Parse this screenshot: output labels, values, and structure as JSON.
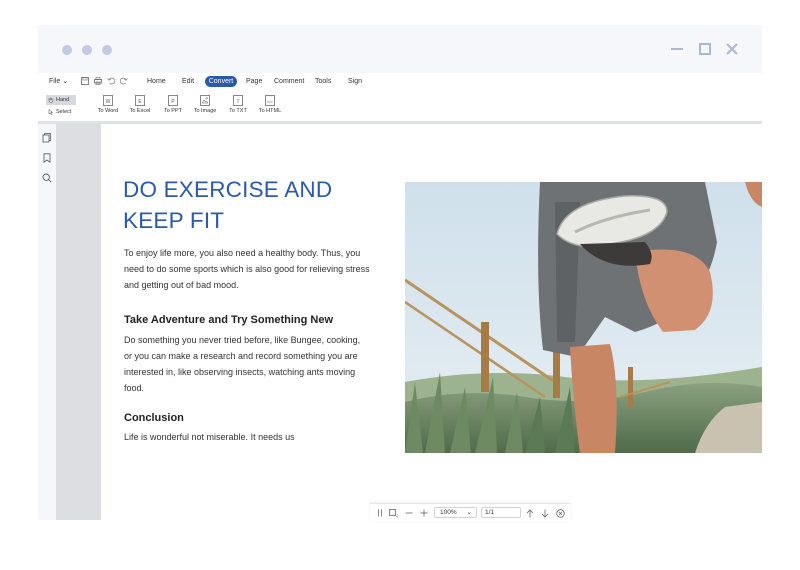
{
  "menu": {
    "file": "File",
    "tabs": [
      "Home",
      "Edit",
      "Convert",
      "Page",
      "Comment",
      "Tools",
      "Sign"
    ],
    "active_tab": "Convert"
  },
  "toolbar": {
    "hand": "Hand",
    "select": "Select",
    "tools": [
      "To Word",
      "To Excel",
      "To PPT",
      "To Image",
      "To TXT",
      "To HTML"
    ]
  },
  "document": {
    "heading_line1": "DO EXERCISE AND",
    "heading_line2": "KEEP FIT",
    "intro": [
      "To enjoy life more, you also need a healthy body. Thus, you",
      "need to do some sports which is also good for relieving stress",
      "and getting out of bad mood."
    ],
    "section1_title": "Take Adventure and Try Something New",
    "section1_body": [
      "Do something you never tried before, like Bungee, cooking,",
      "or you can make a research and record something you are",
      "interested in, like observing insects, watching ants moving",
      "food."
    ],
    "section2_title": "Conclusion",
    "section2_body": "Life is wonderful not miserable. It needs us"
  },
  "bottom_bar": {
    "zoom": "100%",
    "page": "1/1"
  },
  "colors": {
    "accent": "#2a5aa8",
    "heading": "#2b5aa8",
    "traffic": "#c5c9e3",
    "window_controls": "#aeb6d6"
  }
}
